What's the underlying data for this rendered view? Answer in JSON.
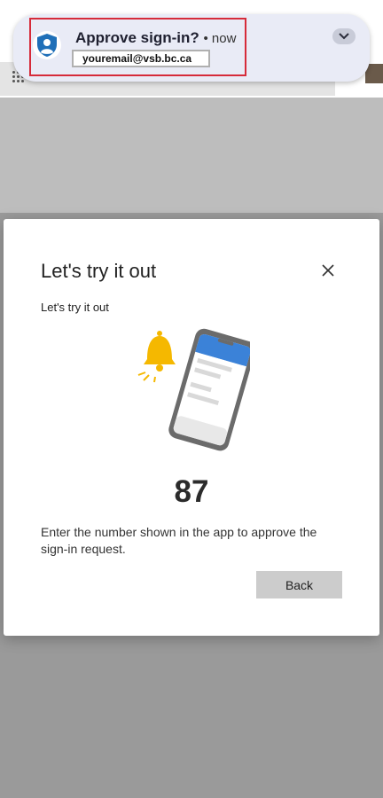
{
  "notification": {
    "title": "Approve sign-in?",
    "time": "• now",
    "email": "youremail@vsb.bc.ca",
    "app_icon": "lock-person-icon",
    "expand_icon": "chevron-down-icon",
    "highlight_color": "#d62b3a"
  },
  "dialog": {
    "title": "Let's try it out",
    "subtitle": "Let's try it out",
    "number": "87",
    "instruction": "Enter the number shown in the app to approve the sign-in request.",
    "back_label": "Back",
    "close_icon": "close-icon",
    "illustration": "phone-notification-bell-illustration"
  },
  "colors": {
    "accent_blue": "#3b82d8",
    "bell_yellow": "#f5b800"
  }
}
